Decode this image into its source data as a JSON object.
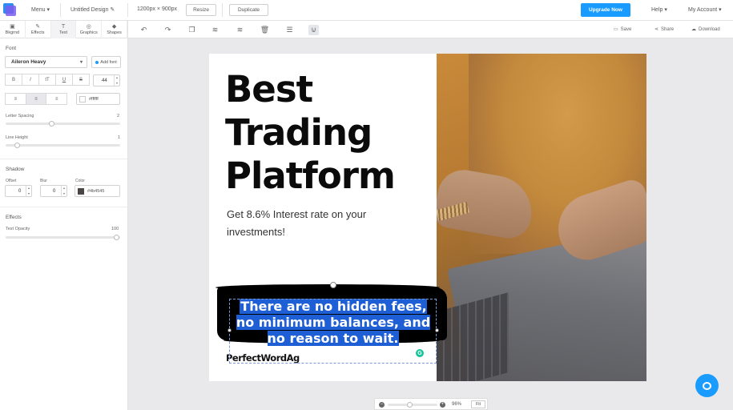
{
  "topbar": {
    "menu_label": "Menu",
    "design_name": "Untitled Design",
    "dimensions": "1200px × 900px",
    "resize_label": "Resize",
    "duplicate_label": "Duplicate",
    "upgrade_label": "Upgrade Now",
    "help_label": "Help",
    "account_label": "My Account"
  },
  "sidetabs": [
    {
      "label": "Bkgrnd"
    },
    {
      "label": "Effects"
    },
    {
      "label": "Text"
    },
    {
      "label": "Graphics"
    },
    {
      "label": "Shapes"
    }
  ],
  "actions": {
    "save": "Save",
    "share": "Share",
    "download": "Download"
  },
  "panel": {
    "font_heading": "Font",
    "font_name": "Aileron Heavy",
    "add_font": "Add font",
    "font_size": "44",
    "style_buttons": [
      "B",
      "I",
      "tT",
      "U",
      "S"
    ],
    "text_color": "#ffffff",
    "letter_spacing_label": "Letter Spacing",
    "letter_spacing_value": "2",
    "line_height_label": "Line Height",
    "line_height_value": "1",
    "shadow_heading": "Shadow",
    "offset_label": "Offset",
    "offset_value": "0",
    "blur_label": "Blur",
    "blur_value": "0",
    "color_label": "Color",
    "shadow_color": "#4b4545",
    "effects_heading": "Effects",
    "opacity_label": "Text Opacity",
    "opacity_value": "100"
  },
  "design": {
    "headline_1": "Best",
    "headline_2": "Trading",
    "headline_3": "Platform",
    "subline": "Get 8.6% Interest rate on your investments!",
    "selected_text": "There are no hidden fees, no minimum balances, and no reason to wait.",
    "brand": "PerfectWordAg"
  },
  "zoom": {
    "level": "96%",
    "fit_label": "Fit"
  },
  "colors": {
    "accent": "#1a9bff",
    "selection": "#1f5fd6"
  }
}
